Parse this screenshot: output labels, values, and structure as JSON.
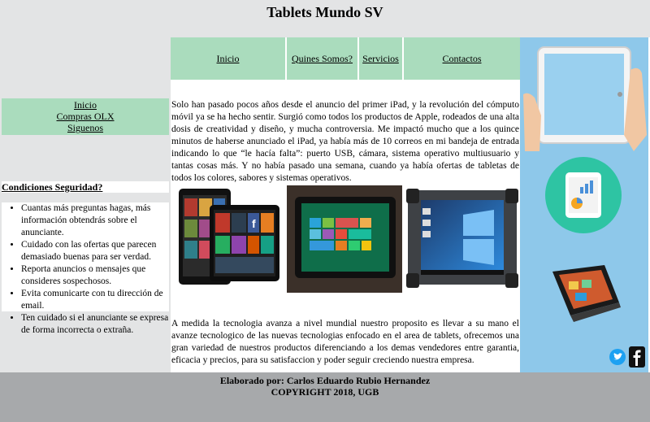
{
  "header": {
    "title": "Tablets Mundo SV"
  },
  "top_nav": [
    {
      "label": "Inicio"
    },
    {
      "label": "Quines Somos?"
    },
    {
      "label": "Servicios"
    },
    {
      "label": "Contactos"
    }
  ],
  "left_nav": [
    {
      "label": "Inicio"
    },
    {
      "label": "Compras OLX"
    },
    {
      "label": "Siguenos"
    }
  ],
  "security": {
    "title": "Condiciones Seguridad?",
    "items": [
      "Cuantas más preguntas hagas, más información obtendrás sobre el anunciante.",
      "Cuidado con las ofertas que parecen demasiado buenas para ser verdad.",
      "Reporta anuncios o mensajes que consideres sospechosos.",
      "Evita comunicarte con tu dirección de email.",
      "Ten cuidado si el anunciante se expresa de forma incorrecta o extraña."
    ]
  },
  "main": {
    "intro": "Solo han pasado pocos años desde el anuncio del primer iPad, y la revolución del cómputo móvil ya se ha hecho sentir. Surgió como todos los productos de Apple, rodeados de una alta dosis de creatividad y diseño, y mucha controversia. Me impactó mucho que a los quince minutos de haberse anunciado el iPad, ya había más de 10 correos en mi bandeja de entrada indicando lo que “le hacía falta”: puerto USB, cámara, sistema operativo multiusuario y tantas cosas más. Y no había pasado una semana, cuando ya había ofertas de tabletas de todos los colores, sabores y sistemas operativos.",
    "closing": "A medida la tecnologia avanza a nivel mundial nuestro proposito es llevar a su mano el avanze tecnologico de las nuevas tecnologias enfocado en el area de tablets, ofrecemos una gran variedad de nuestros productos diferenciando a los demas vendedores entre garantia, eficacia y precios, para su satisfaccion y poder seguir creciendo nuestra empresa."
  },
  "footer": {
    "line1": "Elaborado por: Carlos Eduardo Rubio Hernandez",
    "line2": "COPYRIGHT 2018, UGB"
  },
  "social": {
    "twitter": "twitter-icon",
    "facebook": "facebook-icon"
  }
}
